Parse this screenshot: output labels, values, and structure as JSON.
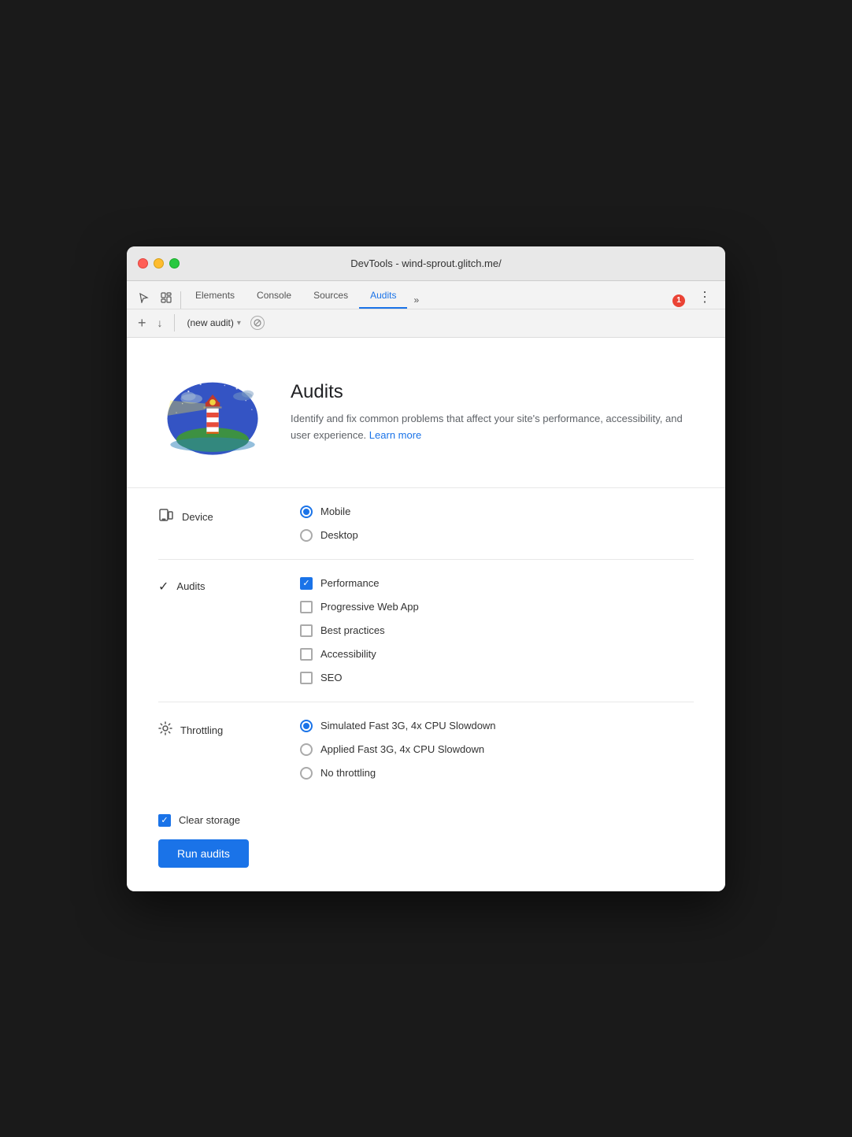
{
  "titlebar": {
    "title": "DevTools - wind-sprout.glitch.me/"
  },
  "nav": {
    "tabs": [
      {
        "id": "elements",
        "label": "Elements",
        "active": false
      },
      {
        "id": "console",
        "label": "Console",
        "active": false
      },
      {
        "id": "sources",
        "label": "Sources",
        "active": false
      },
      {
        "id": "audits",
        "label": "Audits",
        "active": true
      }
    ],
    "more": "»",
    "error_count": "1",
    "kebab": "⋮"
  },
  "audit_toolbar": {
    "add": "+",
    "download": "↓",
    "dropdown_label": "(new audit)",
    "stop_icon": "⊘"
  },
  "hero": {
    "title": "Audits",
    "description": "Identify and fix common problems that affect your site's performance, accessibility, and user experience.",
    "learn_more": "Learn more"
  },
  "device": {
    "label": "Device",
    "options": [
      {
        "id": "mobile",
        "label": "Mobile",
        "checked": true
      },
      {
        "id": "desktop",
        "label": "Desktop",
        "checked": false
      }
    ]
  },
  "audits": {
    "label": "Audits",
    "options": [
      {
        "id": "performance",
        "label": "Performance",
        "checked": true
      },
      {
        "id": "pwa",
        "label": "Progressive Web App",
        "checked": false
      },
      {
        "id": "best-practices",
        "label": "Best practices",
        "checked": false
      },
      {
        "id": "accessibility",
        "label": "Accessibility",
        "checked": false
      },
      {
        "id": "seo",
        "label": "SEO",
        "checked": false
      }
    ]
  },
  "throttling": {
    "label": "Throttling",
    "options": [
      {
        "id": "simulated",
        "label": "Simulated Fast 3G, 4x CPU Slowdown",
        "checked": true
      },
      {
        "id": "applied",
        "label": "Applied Fast 3G, 4x CPU Slowdown",
        "checked": false
      },
      {
        "id": "none",
        "label": "No throttling",
        "checked": false
      }
    ]
  },
  "bottom": {
    "clear_storage_label": "Clear storage",
    "clear_storage_checked": true,
    "run_button": "Run audits"
  }
}
